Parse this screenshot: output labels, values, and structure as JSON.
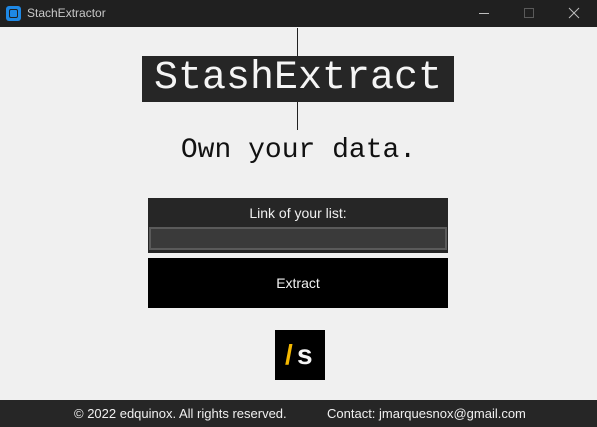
{
  "window": {
    "title": "StachExtractor",
    "titlebar_color": "#202020"
  },
  "icons": {
    "app": "app-icon",
    "minimize": "minimize-icon",
    "maximize": "maximize-icon",
    "close": "close-icon"
  },
  "header": {
    "brand": "StashExtract",
    "tagline": "Own your data."
  },
  "form": {
    "label": "Link of your list:",
    "input_value": "",
    "input_placeholder": "",
    "button_label": "Extract"
  },
  "logo_small": {
    "slash": "/",
    "letter": "s",
    "accent_color": "#f5b800"
  },
  "footer": {
    "copyright": "© 2022 edquinox. All rights reserved.",
    "contact": "Contact: jmarquesnox@gmail.com"
  },
  "colors": {
    "background": "#f0f0f0",
    "dark_panel": "#262626",
    "button": "#000000"
  }
}
